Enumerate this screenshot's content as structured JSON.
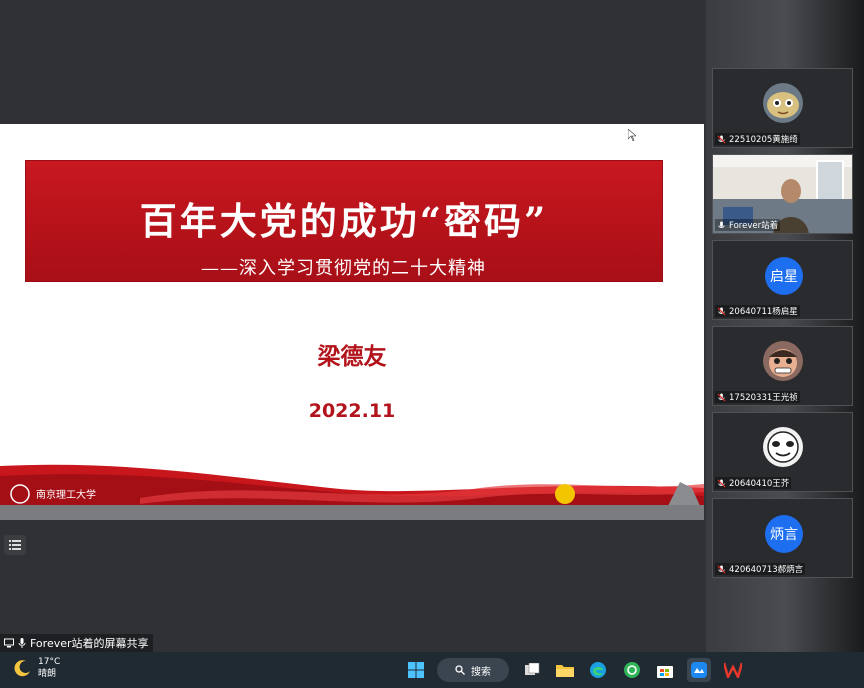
{
  "slide": {
    "title": "百年大党的成功“密码”",
    "subtitle": "——深入学习贯彻党的二十大精神",
    "speaker": "梁德友",
    "date": "2022.11"
  },
  "share_status": "Forever站着的屏幕共享",
  "participants": [
    {
      "name": "22510205黄施绮",
      "avatar": "cartoon-cat"
    },
    {
      "name": "Forever站着",
      "avatar": "video"
    },
    {
      "name": "20640711杨启星",
      "avatar_text": "启星"
    },
    {
      "name": "17520331王光祯",
      "avatar": "cartoon-face"
    },
    {
      "name": "20640410王芥",
      "avatar": "panda-meme"
    },
    {
      "name": "420640713郝炳言",
      "avatar_text": "炳言"
    }
  ],
  "taskbar": {
    "temperature": "17°C",
    "weather": "晴朗",
    "search_label": "搜索"
  },
  "colors": {
    "accent_red": "#b3141b",
    "tile_blue": "#1e6ff0"
  }
}
